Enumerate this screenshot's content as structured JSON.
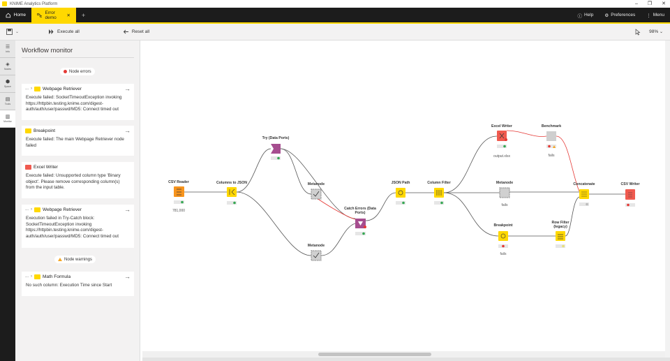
{
  "window": {
    "title": "KNIME Analytics Platform",
    "controls": {
      "minimize": "–",
      "maximize": "❐",
      "close": "✕"
    }
  },
  "tabs": {
    "home": "Home",
    "active": "Error demo",
    "new_tab": "+"
  },
  "top_actions": {
    "help": "Help",
    "preferences": "Preferences",
    "menu": "Menu"
  },
  "toolbar": {
    "execute_all": "Execute all",
    "reset_all": "Reset all",
    "zoom": "98%"
  },
  "left_nav": [
    {
      "label": "Info"
    },
    {
      "label": "Nodes"
    },
    {
      "label": "Space"
    },
    {
      "label": "Tools"
    },
    {
      "label": "Monitor"
    }
  ],
  "monitor": {
    "title": "Workflow monitor",
    "errors_label": "Node errors",
    "warnings_label": "Node warnings",
    "cards": [
      {
        "crumb": "...",
        "node": "Webpage Retriever",
        "color": "#ffd800",
        "lines": [
          "Execute failed: SocketTimeoutException invoking",
          "https://httpbin.testing.knime.com/digest-",
          "auth/auth/user/passwd/MD5: Connect timed out"
        ]
      },
      {
        "crumb": "",
        "node": "Breakpoint",
        "color": "#ffd800",
        "lines": [
          "Execute failed: The main Webpage Retriever node",
          "failed"
        ]
      },
      {
        "crumb": "",
        "node": "Excel Writer",
        "color": "#f05a4f",
        "lines": [
          "Execute failed: Unsupported column type 'Binary",
          "object'. Please remove corresponding column(s)",
          "from the input table."
        ]
      },
      {
        "crumb": "...",
        "node": "Webpage Retriever",
        "color": "#ffd800",
        "lines": [
          "Execution failed in Try-Catch block:",
          "SocketTimeoutException invoking",
          "https://httpbin.testing.knime.com/digest-",
          "auth/auth/user/passwd/MD5: Connect timed out"
        ]
      },
      {
        "crumb": "...",
        "node": "Math Formula",
        "color": "#ffd800",
        "lines": [
          "No such column: Execution Time since Start"
        ]
      }
    ]
  },
  "workflow": {
    "nodes": {
      "csv_reader": {
        "label": "CSV Reader",
        "sub": "781,000"
      },
      "columns_to_json": {
        "label": "Columns to JSON",
        "sub": ""
      },
      "try_data_ports": {
        "label": "Try (Data Ports)",
        "sub": ""
      },
      "metanode_top": {
        "label": "Metanode",
        "sub": ""
      },
      "metanode_bottom": {
        "label": "Metanode",
        "sub": ""
      },
      "catch_errors": {
        "label": "Catch Errors (Data Ports)",
        "sub": ""
      },
      "json_path": {
        "label": "JSON Path",
        "sub": ""
      },
      "column_filter": {
        "label": "Column Filter",
        "sub": ""
      },
      "excel_writer": {
        "label": "Excel Writer",
        "sub": "output.xlsx"
      },
      "benchmark": {
        "label": "Benchmark",
        "sub": "fails"
      },
      "metanode_mid": {
        "label": "Metanode",
        "sub": "fails"
      },
      "breakpoint": {
        "label": "Breakpoint",
        "sub": "fails"
      },
      "row_filter": {
        "label": "Row Filter (legacy)",
        "sub": ""
      },
      "concatenate": {
        "label": "Concatenate",
        "sub": ""
      },
      "csv_writer": {
        "label": "CSV Writer",
        "sub": ""
      }
    }
  },
  "colors": {
    "accent": "#ffd800",
    "source_node": "#f7941d",
    "manipulator_node": "#ffd800",
    "flow_control_node": "#a64d8f",
    "sink_node": "#f05a4f",
    "metanode": "#d0d0d0",
    "error": "#e53935",
    "warning": "#f5a623",
    "ok": "#35a853"
  }
}
